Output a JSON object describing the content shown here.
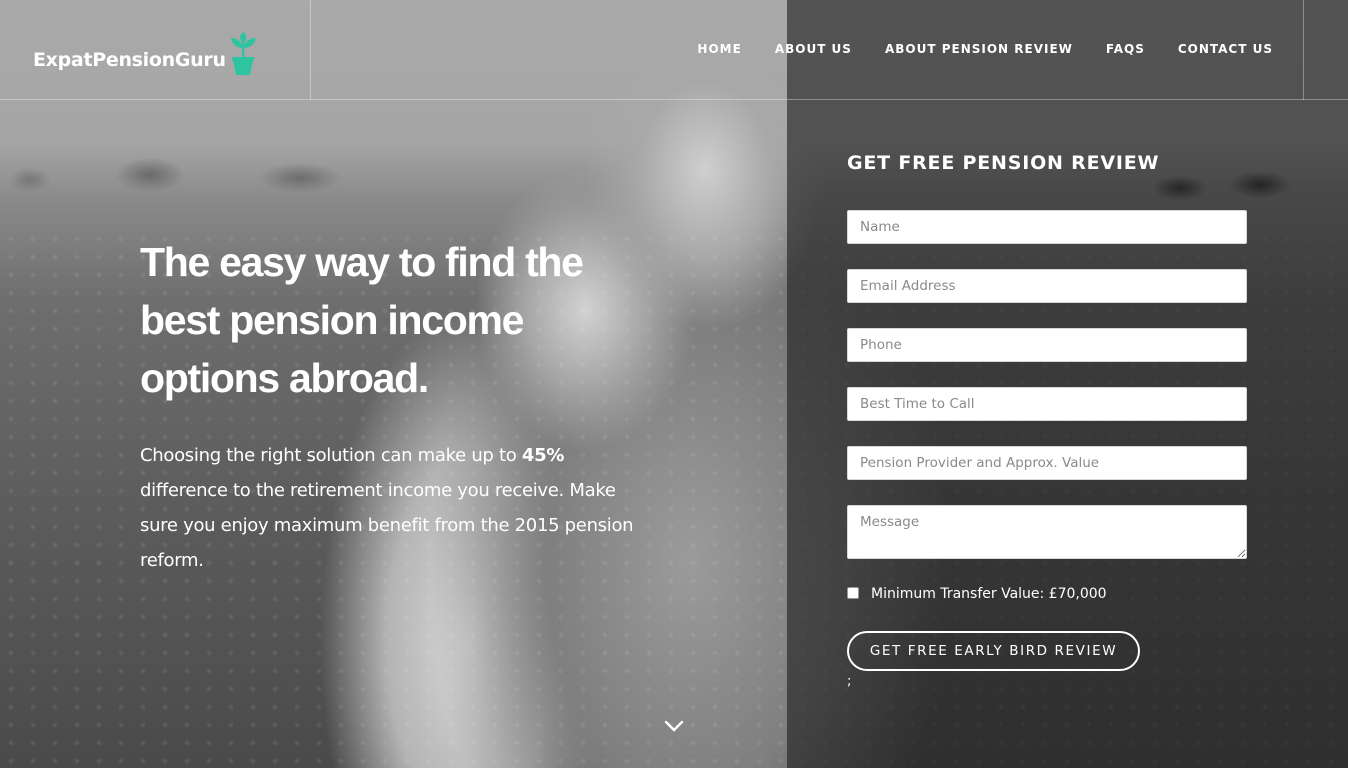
{
  "brand": {
    "name": "ExpatPensionGuru",
    "accent_color": "#2ec4a0",
    "icon": "plant-pot-icon"
  },
  "nav": {
    "items": [
      {
        "label": "HOME"
      },
      {
        "label": "ABOUT US"
      },
      {
        "label": "ABOUT PENSION REVIEW"
      },
      {
        "label": "FAQS"
      },
      {
        "label": "CONTACT US"
      }
    ]
  },
  "hero": {
    "title": "The easy way to find the best pension income options abroad.",
    "copy_before": "Choosing the right solution can make up to ",
    "copy_highlight": "45%",
    "copy_after": " difference to the retirement income you receive. Make sure you enjoy maximum benefit from the 2015 pension reform.",
    "scroll_icon": "chevron-down-icon"
  },
  "form": {
    "title": "GET FREE PENSION REVIEW",
    "fields": {
      "name": {
        "placeholder": "Name",
        "value": ""
      },
      "email": {
        "placeholder": "Email Address",
        "value": ""
      },
      "phone": {
        "placeholder": "Phone",
        "value": ""
      },
      "best_time": {
        "placeholder": "Best Time to Call",
        "value": ""
      },
      "provider": {
        "placeholder": "Pension Provider and Approx. Value",
        "value": ""
      },
      "message": {
        "placeholder": "Message",
        "value": ""
      }
    },
    "checkbox_label": "Minimum Transfer Value: £70,000",
    "checkbox_checked": false,
    "submit_label": "GET FREE EARLY BIRD REVIEW",
    "stray_text": ";"
  }
}
